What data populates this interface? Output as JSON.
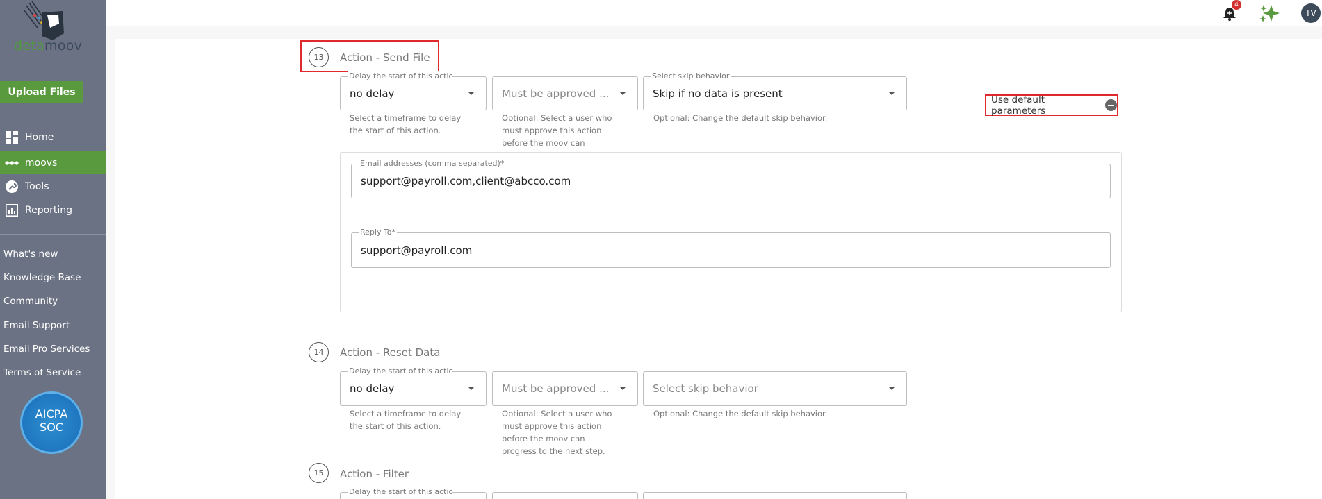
{
  "sidebar": {
    "logo_text_a": "deta",
    "logo_text_b": "moov",
    "upload_label": "Upload Files",
    "nav": [
      {
        "label": "Home",
        "icon": "dashboard-icon"
      },
      {
        "label": "moovs",
        "icon": "moovs-dots-icon"
      },
      {
        "label": "Tools",
        "icon": "wrench-icon"
      },
      {
        "label": "Reporting",
        "icon": "bar-chart-icon"
      }
    ],
    "links": [
      "What's new",
      "Knowledge Base",
      "Community",
      "Email Support",
      "Email Pro Services",
      "Terms of Service"
    ],
    "badge": {
      "line1": "AICPA",
      "line2": "SOC"
    }
  },
  "topbar": {
    "notification_count": "4",
    "avatar_initials": "TV"
  },
  "colors": {
    "accent": "#5a9a3f",
    "sidebar": "#6b7283",
    "highlight": "#e0282f"
  },
  "defaults": {
    "label": "Use default parameters"
  },
  "steps": [
    {
      "num": "13",
      "title": "Action - Send File",
      "delay_label": "Delay the start of this action",
      "delay_value": "no delay",
      "delay_helper": [
        "Select a timeframe to delay",
        "the start of this action."
      ],
      "approve_placeholder": "Must be approved ...",
      "approve_helper": [
        "Optional: Select a user who",
        "must approve this action",
        "before the moov can"
      ],
      "skip_label": "Select skip behavior",
      "skip_value": "Skip if no data is present",
      "skip_helper": "Optional: Change the default skip behavior.",
      "email_label": "Email addresses (comma separated)*",
      "email_value": "support@payroll.com,client@abcco.com",
      "reply_label": "Reply To*",
      "reply_value": "support@payroll.com"
    },
    {
      "num": "14",
      "title": "Action - Reset Data",
      "delay_label": "Delay the start of this action",
      "delay_value": "no delay",
      "delay_helper": [
        "Select a timeframe to delay",
        "the start of this action."
      ],
      "approve_placeholder": "Must be approved ...",
      "approve_helper": [
        "Optional: Select a user who",
        "must approve this action",
        "before the moov can",
        "progress to the next step."
      ],
      "skip_placeholder": "Select skip behavior",
      "skip_helper": "Optional: Change the default skip behavior."
    },
    {
      "num": "15",
      "title": "Action - Filter",
      "delay_label": "Delay the start of this action"
    }
  ]
}
